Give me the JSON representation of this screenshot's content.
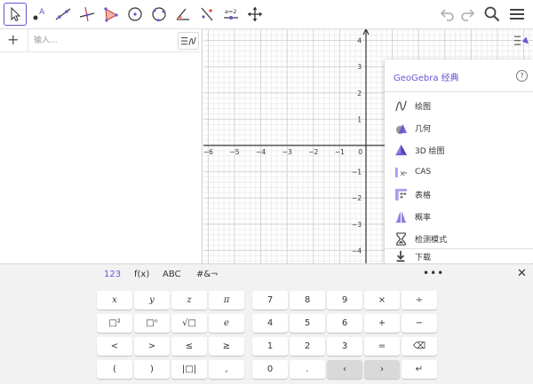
{
  "toolbar": {
    "tools": [
      {
        "name": "move-tool",
        "icon": "cursor-arrow"
      },
      {
        "name": "point-tool",
        "icon": "point-a"
      },
      {
        "name": "line-tool",
        "icon": "line-through-points"
      },
      {
        "name": "perpendicular-tool",
        "icon": "perpendicular-line"
      },
      {
        "name": "polygon-tool",
        "icon": "triangle"
      },
      {
        "name": "circle-center-tool",
        "icon": "circle-with-center"
      },
      {
        "name": "circle-three-points-tool",
        "icon": "circle-three-points"
      },
      {
        "name": "angle-tool",
        "icon": "angle"
      },
      {
        "name": "reflect-tool",
        "icon": "reflect-about-line"
      },
      {
        "name": "slider-tool",
        "icon": "slider"
      },
      {
        "name": "move-view-tool",
        "icon": "cross-arrows"
      }
    ],
    "slider_label": "a=2",
    "point_label": "A"
  },
  "algebra": {
    "plus": "+",
    "input_placeholder": "输入..."
  },
  "graphics": {
    "x_labels": [
      "−6",
      "−5",
      "−4",
      "−3",
      "−2",
      "−1",
      "0"
    ],
    "y_labels_pos": [
      "4",
      "3",
      "2",
      "1"
    ],
    "y_labels_neg": [
      "−1",
      "−2",
      "−3",
      "−4"
    ]
  },
  "menu": {
    "title": "GeoGebra 经典",
    "help": "?",
    "items": [
      {
        "label": "绘图",
        "icon": "graphing-icon"
      },
      {
        "label": "几何",
        "icon": "geometry-icon"
      },
      {
        "label": "3D 绘图",
        "icon": "3d-graphing-icon"
      },
      {
        "label": "CAS",
        "icon": "cas-icon"
      },
      {
        "label": "表格",
        "icon": "spreadsheet-icon"
      },
      {
        "label": "概率",
        "icon": "probability-icon"
      },
      {
        "label": "检测模式",
        "icon": "exam-mode-icon"
      },
      {
        "label": "下载",
        "icon": "download-icon"
      }
    ]
  },
  "keyboard": {
    "tabs": [
      "123",
      "f(x)",
      "ABC",
      "#&¬"
    ],
    "more": "•••",
    "close": "✕",
    "left_keys": [
      "x",
      "y",
      "z",
      "π",
      "□²",
      "□ⁿ",
      "√□",
      "e",
      "<",
      ">",
      "≤",
      "≥",
      "(",
      ")",
      "|□|",
      ","
    ],
    "num_keys": [
      "7",
      "8",
      "9",
      "×",
      "÷",
      "4",
      "5",
      "6",
      "+",
      "−",
      "1",
      "2",
      "3",
      "=",
      "⌫",
      "0",
      ".",
      "‹",
      "›",
      "↵"
    ]
  },
  "colors": {
    "accent": "#6557d2",
    "grid_minor": "#eeeeee",
    "grid_major": "#d6d6d6",
    "axis": "#333333"
  }
}
